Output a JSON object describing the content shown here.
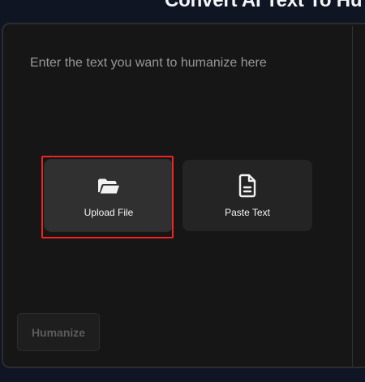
{
  "header": {
    "title": "Convert AI Text To Hu"
  },
  "editor": {
    "placeholder": "Enter the text you want to humanize here",
    "actions": [
      {
        "label": "Upload File",
        "icon": "folder-open-icon",
        "highlighted": true
      },
      {
        "label": "Paste Text",
        "icon": "document-icon",
        "highlighted": false
      }
    ],
    "submit_label": "Humanize",
    "submit_disabled": true
  },
  "colors": {
    "page_background": "#0f1522",
    "panel_background": "#161616",
    "tile_background": "#242424",
    "highlight": "#ef2424",
    "muted_text": "#96989c"
  }
}
